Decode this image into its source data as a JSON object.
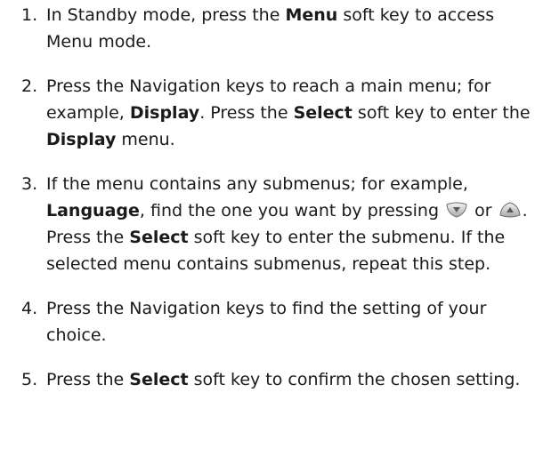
{
  "steps": [
    {
      "num": "1.",
      "t1": "In Standby mode, press the ",
      "b1": "Menu",
      "t2": " soft key to access Menu mode."
    },
    {
      "num": "2.",
      "t1": "Press the Navigation keys to reach a main menu; for example, ",
      "b1": "Display",
      "t2": ". Press the ",
      "b2": "Select",
      "t3": " soft key to enter the ",
      "b3": "Display",
      "t4": " menu."
    },
    {
      "num": "3.",
      "t1": "If the menu contains any submenus; for example, ",
      "b1": "Language",
      "t2": ", find the one you want by pressing ",
      "icon1": "nav-down-key-icon",
      "t3": " or ",
      "icon2": "nav-up-key-icon",
      "t4": ". Press the ",
      "b2": "Select",
      "t5": " soft key to enter the submenu. If the selected menu contains submenus, repeat this step."
    },
    {
      "num": "4.",
      "t1": "Press the Navigation keys to find the setting of your choice."
    },
    {
      "num": "5.",
      "t1": "Press the ",
      "b1": "Select",
      "t2": " soft key to confirm the chosen setting."
    }
  ]
}
